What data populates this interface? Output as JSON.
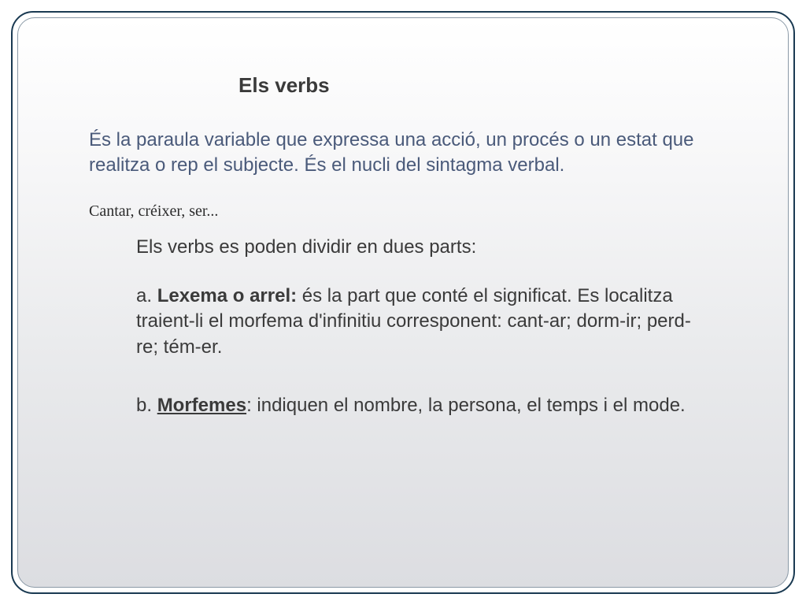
{
  "title": "Els verbs",
  "definition": "És la paraula variable que expressa una acció, un procés o un estat que realitza o rep el subjecte. És el nucli del sintagma verbal.",
  "examples": "Cantar, créixer, ser...",
  "intro": "Els verbs es poden dividir en dues parts:",
  "itemA": {
    "prefix": "a. ",
    "label": "Lexema o arrel:",
    "rest": " és la part que conté el significat. Es localitza traient-li el morfema d'infinitiu corresponent: cant-ar; dorm-ir; perd-re; tém-er."
  },
  "itemB": {
    "prefix": "b. ",
    "label": "Morfemes",
    "rest": ": indiquen el nombre, la persona, el temps i el mode."
  }
}
